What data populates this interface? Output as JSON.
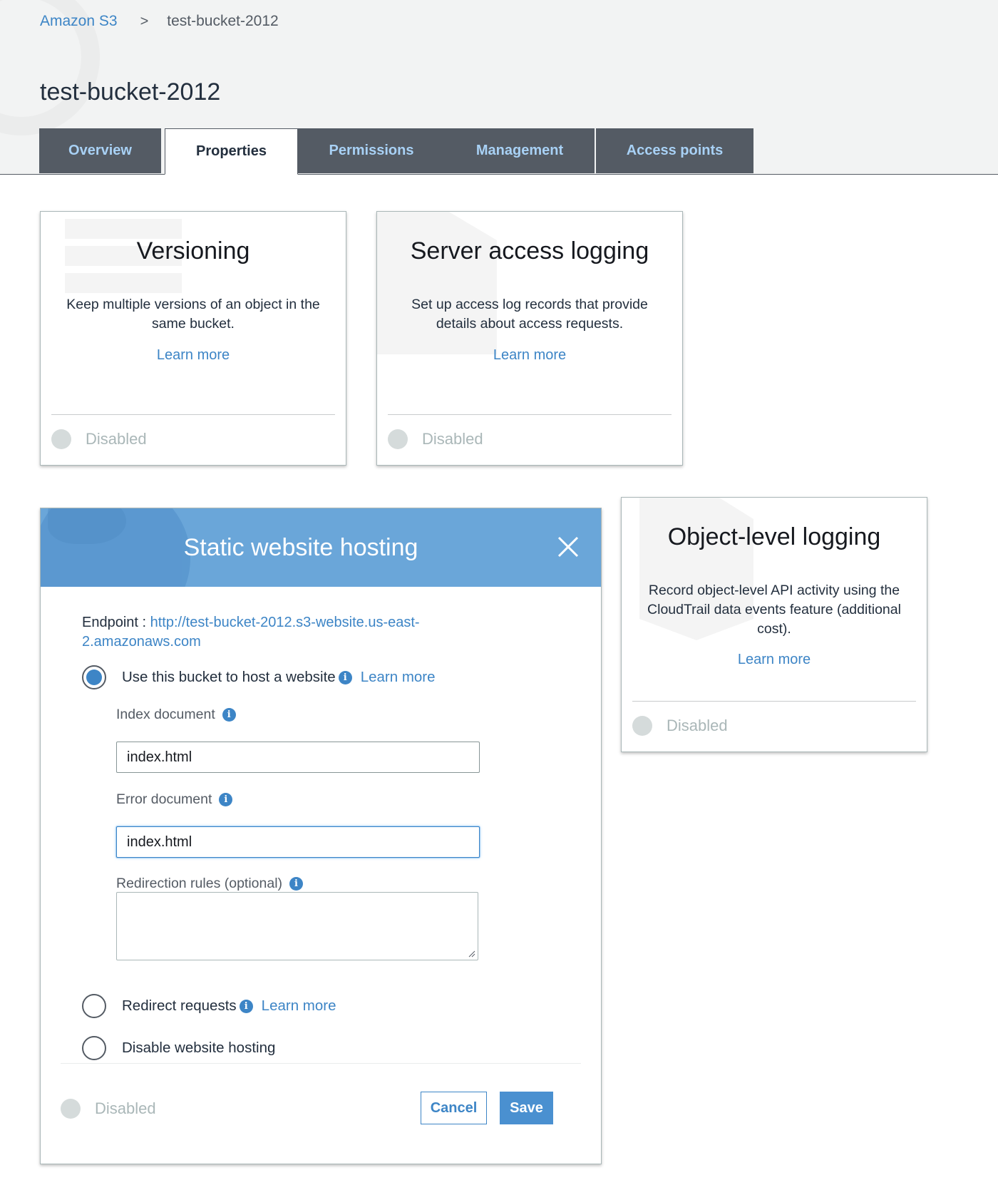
{
  "breadcrumb": {
    "root": "Amazon S3",
    "separator": ">",
    "current": "test-bucket-2012"
  },
  "page": {
    "title": "test-bucket-2012"
  },
  "tabs": [
    {
      "label": "Overview",
      "active": false
    },
    {
      "label": "Properties",
      "active": true
    },
    {
      "label": "Permissions",
      "active": false
    },
    {
      "label": "Management",
      "active": false
    },
    {
      "label": "Access points",
      "active": false
    }
  ],
  "cards": {
    "versioning": {
      "title": "Versioning",
      "description": "Keep multiple versions of an object in the same bucket.",
      "link": "Learn more",
      "status": "Disabled"
    },
    "server_access_logging": {
      "title": "Server access logging",
      "description": "Set up access log records that provide details about access requests.",
      "link": "Learn more",
      "status": "Disabled"
    },
    "object_level_logging": {
      "title": "Object-level logging",
      "description": "Record object-level API activity using the CloudTrail data events feature (additional cost).",
      "link": "Learn more",
      "status": "Disabled"
    }
  },
  "static_hosting": {
    "title": "Static website hosting",
    "endpoint_label": "Endpoint : ",
    "endpoint_url": "http://test-bucket-2012.s3-website.us-east-2.amazonaws.com",
    "option_host": "Use this bucket to host a website",
    "option_host_link": "Learn more",
    "index_label": "Index document",
    "index_value": "index.html",
    "error_label": "Error document",
    "error_value": "index.html",
    "redirection_label": "Redirection rules (optional)",
    "redirection_value": "",
    "option_redirect": "Redirect requests",
    "option_redirect_link": "Learn more",
    "option_disable": "Disable website hosting",
    "status": "Disabled",
    "cancel_label": "Cancel",
    "save_label": "Save",
    "selected_option": "host"
  },
  "icons": {
    "info": "info-icon",
    "close": "close-icon",
    "status": "status-dot"
  },
  "colors": {
    "link": "#3d85c6",
    "tab_bg": "#545b64",
    "tab_text": "#a8d1f5",
    "panel_header": "#6aa6d9",
    "primary_button": "#4a90d0",
    "disabled": "#aab7b8"
  }
}
